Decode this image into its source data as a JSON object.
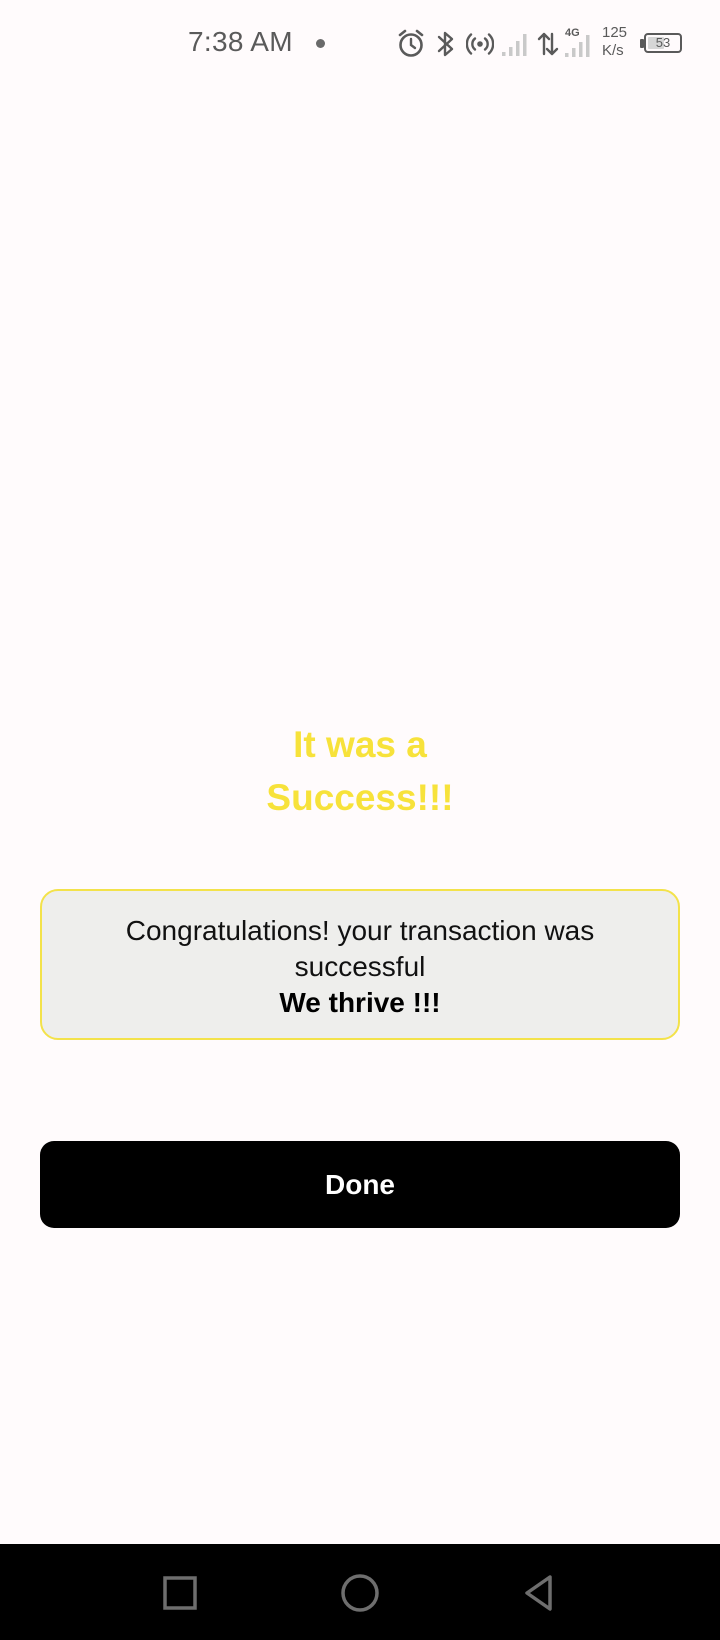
{
  "status_bar": {
    "time": "7:38 AM",
    "network_speed_value": "125",
    "network_speed_unit": "K/s",
    "network_type": "4G",
    "battery_level": "53",
    "battery_percent": 53,
    "icons": [
      "alarm-icon",
      "bluetooth-icon",
      "hotspot-icon",
      "signal-icon",
      "data-transfer-icon",
      "signal-4g-icon",
      "battery-icon"
    ]
  },
  "success": {
    "title_line1": "It was a",
    "title_line2": "Success!!!",
    "message": "Congratulations!  your transaction was successful",
    "submessage": "We thrive !!!",
    "done_label": "Done"
  },
  "nav_bar": {
    "buttons": [
      "recents-square-icon",
      "home-circle-icon",
      "back-triangle-icon"
    ]
  },
  "colors": {
    "accent_yellow": "#f7e23a",
    "card_background": "#eeeeec",
    "card_border": "#f3e24a",
    "button_background": "#000000",
    "page_background": "#fffbfc"
  }
}
